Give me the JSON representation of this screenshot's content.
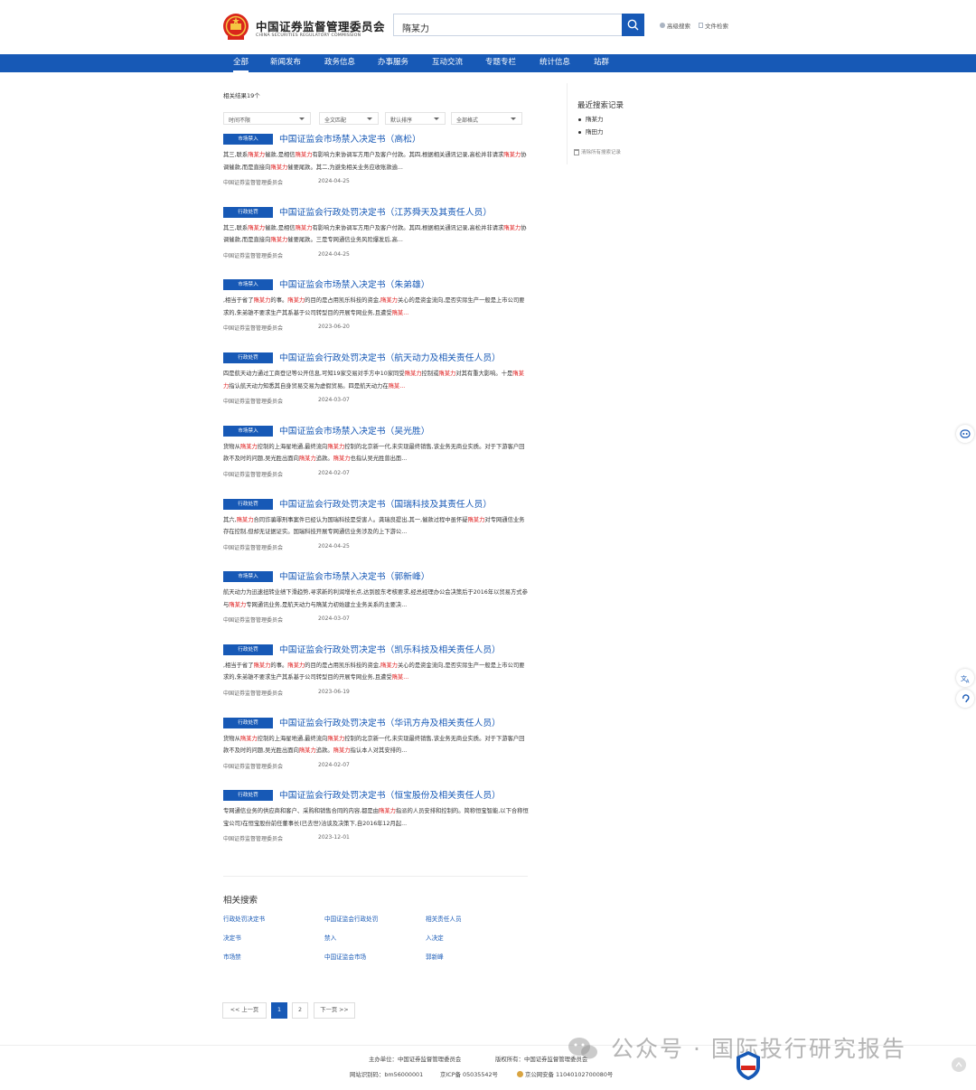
{
  "header": {
    "org_name_cn": "中国证券监督管理委员会",
    "org_name_en": "CHINA SECURITIES REGULATORY COMMISSION",
    "search_value": "隋某力",
    "advanced_search": "高级搜索",
    "doc_search": "文件检索"
  },
  "nav": {
    "items": [
      "全部",
      "新闻发布",
      "政务信息",
      "办事服务",
      "互动交流",
      "专题专栏",
      "统计信息",
      "站群"
    ]
  },
  "results_header": {
    "count_text": "相关结果19个"
  },
  "filters": [
    "时间不限",
    "全文匹配",
    "默认排序",
    "全部格式"
  ],
  "results": [
    {
      "tag": "市场禁入",
      "title": "中国证监会市场禁入决定书（高松）",
      "snippet": [
        {
          "t": "其三,联系"
        },
        {
          "t": "隋某力",
          "hl": true
        },
        {
          "t": "催款,是相信"
        },
        {
          "t": "隋某力",
          "hl": true
        },
        {
          "t": "有影响力来协调军方用户及客户付款。其四,根据相关通讯记录,高松并非请求"
        },
        {
          "t": "隋某力",
          "hl": true
        },
        {
          "t": "协调催款,而是直接向"
        },
        {
          "t": "隋某力",
          "hl": true
        },
        {
          "t": "催要尾款。其二,为避免相关业务应收账款逾..."
        }
      ],
      "source": "中国证券监督管理委员会",
      "date": "2024-04-25"
    },
    {
      "tag": "行政处罚",
      "title": "中国证监会行政处罚决定书（江苏舜天及其责任人员）",
      "snippet": [
        {
          "t": "其三,联系"
        },
        {
          "t": "隋某力",
          "hl": true
        },
        {
          "t": "催款,是相信"
        },
        {
          "t": "隋某力",
          "hl": true
        },
        {
          "t": "有影响力来协调军方用户及客户付款。其四,根据相关通讯记录,高松并非请求"
        },
        {
          "t": "隋某力",
          "hl": true
        },
        {
          "t": "协调催款,而是直接向"
        },
        {
          "t": "隋某力",
          "hl": true
        },
        {
          "t": "催要尾款。三是专网通信业务风险爆发后,高..."
        }
      ],
      "source": "中国证券监督管理委员会",
      "date": "2024-04-25"
    },
    {
      "tag": "市场禁入",
      "title": "中国证监会市场禁入决定书（朱弟雄）",
      "snippet": [
        {
          "t": ",相当于省了"
        },
        {
          "t": "隋某力",
          "hl": true
        },
        {
          "t": "的事。"
        },
        {
          "t": "隋某力",
          "hl": true
        },
        {
          "t": "的目的是占用凯乐科技的资金,"
        },
        {
          "t": "隋某力",
          "hl": true
        },
        {
          "t": "关心的是资金流向,是否实际生产一般是上市公司要求的,朱弟雄不要求生产其系基于公司转型目的开展专网业务,且遭受"
        },
        {
          "t": "隋某...",
          "hl": true
        }
      ],
      "source": "中国证券监督管理委员会",
      "date": "2023-06-20"
    },
    {
      "tag": "行政处罚",
      "title": "中国证监会行政处罚决定书（航天动力及相关责任人员）",
      "snippet": [
        {
          "t": "四是航天动力通过工商登记等公开信息,可知19家交易对手方中10家同受"
        },
        {
          "t": "隋某力",
          "hl": true
        },
        {
          "t": "控制或"
        },
        {
          "t": "隋某力",
          "hl": true
        },
        {
          "t": "对其有重大影响。十是"
        },
        {
          "t": "隋某力",
          "hl": true
        },
        {
          "t": "指认航天动力知悉其自身贸易交易为虚假贸易。四是航天动力在"
        },
        {
          "t": "隋某...",
          "hl": true
        }
      ],
      "source": "中国证券监督管理委员会",
      "date": "2024-03-07"
    },
    {
      "tag": "市场禁入",
      "title": "中国证监会市场禁入决定书（吴光胜）",
      "snippet": [
        {
          "t": "货物从"
        },
        {
          "t": "隋某力",
          "hl": true
        },
        {
          "t": "控制的上海星地通,最终流向"
        },
        {
          "t": "隋某力",
          "hl": true
        },
        {
          "t": "控制的北京新一代,未实现最终销售,该业务无商业实质。对于下游客户回款不及时的问题,吴光胜出面向"
        },
        {
          "t": "隋某力",
          "hl": true
        },
        {
          "t": "追款。"
        },
        {
          "t": "隋某力",
          "hl": true
        },
        {
          "t": "也指认吴光胜曾出面..."
        }
      ],
      "source": "中国证券监督管理委员会",
      "date": "2024-02-07"
    },
    {
      "tag": "行政处罚",
      "title": "中国证监会行政处罚决定书（国瑞科技及其责任人员）",
      "snippet": [
        {
          "t": "其六,"
        },
        {
          "t": "隋某力",
          "hl": true
        },
        {
          "t": "合同诈骗罪刑事案件已经认为国瑞科技是受害人。龚瑞良提出,其一,催款过程中虽怀疑"
        },
        {
          "t": "隋某力",
          "hl": true
        },
        {
          "t": "对专网通信业务存在控制,但却无证据证实。国瑞科技开展专网通信业务涉及的上下游公..."
        }
      ],
      "source": "中国证券监督管理委员会",
      "date": "2024-04-25"
    },
    {
      "tag": "市场禁入",
      "title": "中国证监会市场禁入决定书（郭新峰）",
      "snippet": [
        {
          "t": "航天动力为迅速扭转业绩下滑趋势,寻求新的利润增长点,达到股东考核要求,经总经理办公会决策后于2016年以贸易方式参与"
        },
        {
          "t": "隋某力",
          "hl": true
        },
        {
          "t": "专网通讯业务,是航天动力与隋某力初始建立业务关系的主要决..."
        }
      ],
      "source": "中国证券监督管理委员会",
      "date": "2024-03-07"
    },
    {
      "tag": "行政处罚",
      "title": "中国证监会行政处罚决定书（凯乐科技及相关责任人员）",
      "snippet": [
        {
          "t": ",相当于省了"
        },
        {
          "t": "隋某力",
          "hl": true
        },
        {
          "t": "的事。"
        },
        {
          "t": "隋某力",
          "hl": true
        },
        {
          "t": "的目的是占用凯乐科技的资金,"
        },
        {
          "t": "隋某力",
          "hl": true
        },
        {
          "t": "关心的是资金流向,是否实际生产一般是上市公司要求的,朱弟雄不要求生产其系基于公司转型目的开展专网业务,且遭受"
        },
        {
          "t": "隋某...",
          "hl": true
        }
      ],
      "source": "中国证券监督管理委员会",
      "date": "2023-06-19"
    },
    {
      "tag": "行政处罚",
      "title": "中国证监会行政处罚决定书（华讯方舟及相关责任人员）",
      "snippet": [
        {
          "t": "货物从"
        },
        {
          "t": "隋某力",
          "hl": true
        },
        {
          "t": "控制的上海星地通,最终流向"
        },
        {
          "t": "隋某力",
          "hl": true
        },
        {
          "t": "控制的北京新一代,未实现最终销售,该业务无商业实质。对于下游客户回款不及时的问题,吴光胜出面向"
        },
        {
          "t": "隋某力",
          "hl": true
        },
        {
          "t": "追款。"
        },
        {
          "t": "隋某力",
          "hl": true
        },
        {
          "t": "指认本人对其安排的..."
        }
      ],
      "source": "中国证券监督管理委员会",
      "date": "2024-02-07"
    },
    {
      "tag": "行政处罚",
      "title": "中国证监会行政处罚决定书（恒宝股份及相关责任人员）",
      "snippet": [
        {
          "t": "专网通信业务的供应商和客户、采购和销售合同的内容,都是由"
        },
        {
          "t": "隋某力",
          "hl": true
        },
        {
          "t": "指派的人员安排和控制的。简称恒宝智能,以下合称恒宝公司)在恒宝股份前任董事长(已去世)洽谈及决策下,自2016年12月起..."
        }
      ],
      "source": "中国证券监督管理委员会",
      "date": "2023-12-01"
    }
  ],
  "related": {
    "title": "相关搜索",
    "links": [
      "行政处罚决定书",
      "中国证监会行政处罚",
      "相关责任人员",
      "决定书",
      "禁入",
      "入决定",
      "市场禁",
      "中国证监会市场",
      "郭新峰"
    ]
  },
  "pagination": {
    "prev": "<< 上一页",
    "pages": [
      "1",
      "2"
    ],
    "current": "1",
    "next": "下一页 >>"
  },
  "sidebar": {
    "recent_title": "最近搜索记录",
    "recent_items": [
      "隋某力",
      "隋田力"
    ],
    "clear_label": "清除所有搜索记录"
  },
  "footer": {
    "host": "主办单位：中国证券监督管理委员会",
    "copyright": "版权所有：中国证券监督管理委员会",
    "site_id": "网站识别码：bm56000001",
    "icp": "京ICP备 05035542号",
    "police": "京公网安备 11040102700080号"
  },
  "watermark": "公众号 · 国际投行研究报告",
  "colors": {
    "brand_blue": "#1759b6",
    "highlight_red": "#e02020"
  }
}
